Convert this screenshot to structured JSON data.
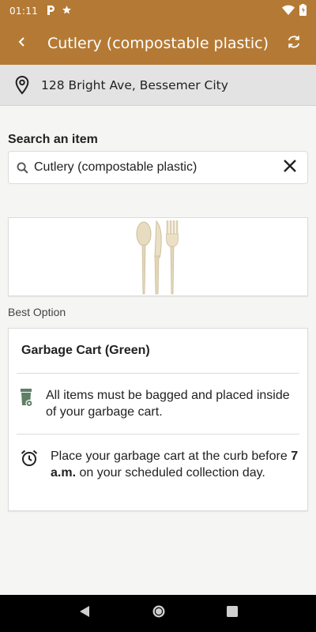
{
  "status_bar": {
    "time": "01:11",
    "icons": [
      "parking-icon",
      "star-icon",
      "wifi-icon",
      "battery-icon"
    ]
  },
  "app_bar": {
    "title": "Cutlery (compostable plastic)",
    "icons": [
      "back-icon",
      "refresh-icon"
    ]
  },
  "location": {
    "address": "128 Bright Ave, Bessemer City",
    "icon": "location-pin-icon"
  },
  "search": {
    "label": "Search an item",
    "value": "Cutlery (compostable plastic)",
    "icons": [
      "search-icon",
      "close-icon"
    ]
  },
  "item_image": {
    "icon": "cutlery-image"
  },
  "best_option": {
    "label": "Best Option",
    "title": "Garbage Cart (Green)",
    "instruction": "All items must be bagged and placed inside of your garbage cart.",
    "schedule_before": "Place your garbage cart at the curb before ",
    "schedule_time": "7 a.m.",
    "schedule_after": " on your scheduled collection day.",
    "cart_color": "#5f7f66"
  },
  "colors": {
    "brand": "#b47a35",
    "address_bg": "#e3e3e3",
    "page_bg": "#f5f5f3"
  },
  "nav_bar": {
    "icons": [
      "nav-back-icon",
      "nav-home-icon",
      "nav-recents-icon"
    ]
  }
}
